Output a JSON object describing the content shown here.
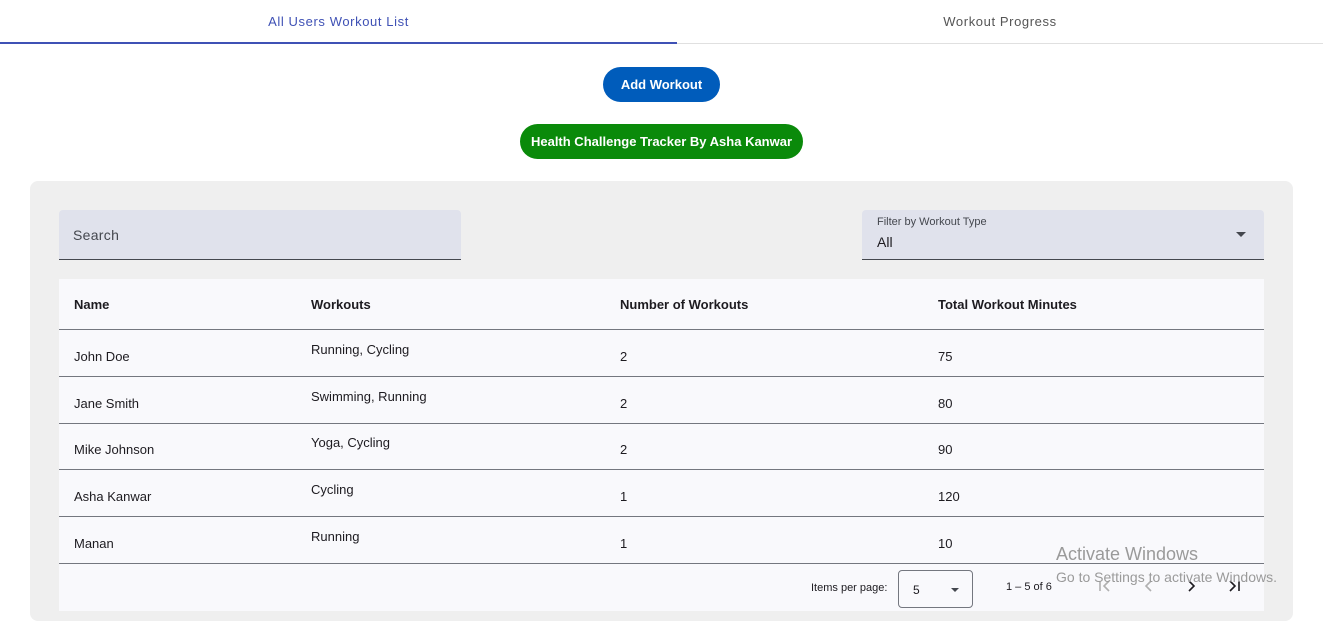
{
  "tabs": [
    {
      "label": "All Users Workout List",
      "active": true
    },
    {
      "label": "Workout Progress",
      "active": false
    }
  ],
  "buttons": {
    "add_workout": "Add Workout",
    "tracker_title": "Health Challenge Tracker By Asha Kanwar"
  },
  "colors": {
    "accent": "#3f51b5",
    "primary_button": "#005cbb",
    "title_button": "#0a8a0a"
  },
  "search": {
    "placeholder": "Search"
  },
  "filter": {
    "label": "Filter by Workout Type",
    "value": "All"
  },
  "table": {
    "headers": [
      "Name",
      "Workouts",
      "Number of Workouts",
      "Total Workout Minutes"
    ],
    "rows": [
      {
        "name": "John Doe",
        "workouts": "Running, Cycling",
        "count": "2",
        "minutes": "75"
      },
      {
        "name": "Jane Smith",
        "workouts": "Swimming, Running",
        "count": "2",
        "minutes": "80"
      },
      {
        "name": "Mike Johnson",
        "workouts": "Yoga, Cycling",
        "count": "2",
        "minutes": "90"
      },
      {
        "name": "Asha Kanwar",
        "workouts": "Cycling",
        "count": "1",
        "minutes": "120"
      },
      {
        "name": "Manan",
        "workouts": "Running",
        "count": "1",
        "minutes": "10"
      }
    ]
  },
  "paginator": {
    "items_per_page_label": "Items per page:",
    "page_size": "5",
    "range": "1 – 5 of 6"
  },
  "watermark": {
    "line1": "Activate Windows",
    "line2": "Go to Settings to activate Windows."
  },
  "icons": {
    "dropdown": "arrow-drop-down-icon",
    "first": "first-page-icon",
    "prev": "chevron-left-icon",
    "next": "chevron-right-icon",
    "last": "last-page-icon"
  }
}
